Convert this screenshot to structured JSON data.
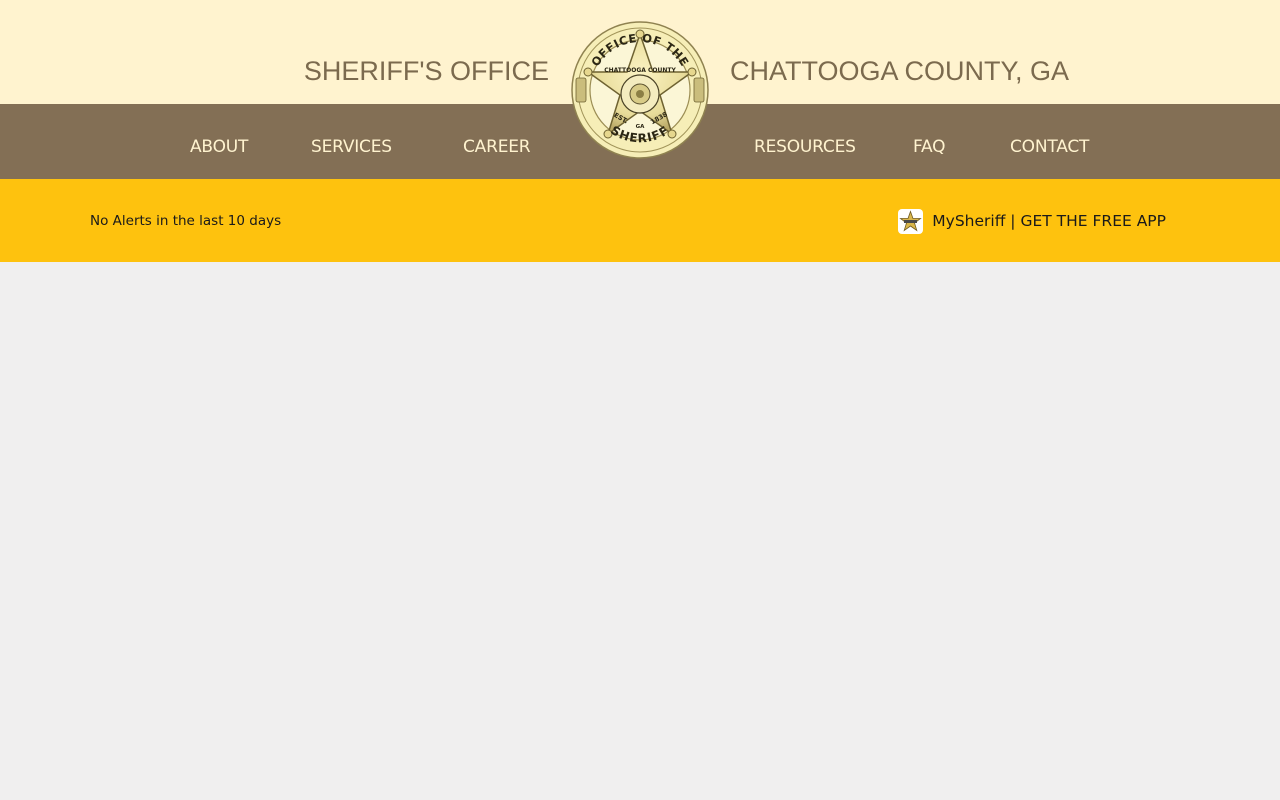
{
  "header": {
    "title_left": "SHERIFF'S OFFICE",
    "title_right": "CHATTOOGA COUNTY, GA",
    "badge_text": {
      "top": "OFFICE OF THE",
      "bottom": "SHERIFF",
      "county": "CHATTOOGA COUNTY",
      "est": "EST.",
      "year": "1838",
      "state": "GA"
    }
  },
  "nav": {
    "items": [
      {
        "label": "ABOUT"
      },
      {
        "label": "SERVICES"
      },
      {
        "label": "CAREER"
      },
      {
        "label": "RESOURCES"
      },
      {
        "label": "FAQ"
      },
      {
        "label": "CONTACT"
      }
    ]
  },
  "alerts": {
    "text": "No Alerts in the last 10 days"
  },
  "app": {
    "label": "MySheriff | GET THE FREE APP",
    "icon": "sheriff-star-icon"
  },
  "colors": {
    "topband": "#fff3cf",
    "navbar": "#836f55",
    "nav_text": "#fff3cf",
    "title_text": "#7b6a4e",
    "alertbar": "#fec20e",
    "page_bg": "#f0efef"
  }
}
